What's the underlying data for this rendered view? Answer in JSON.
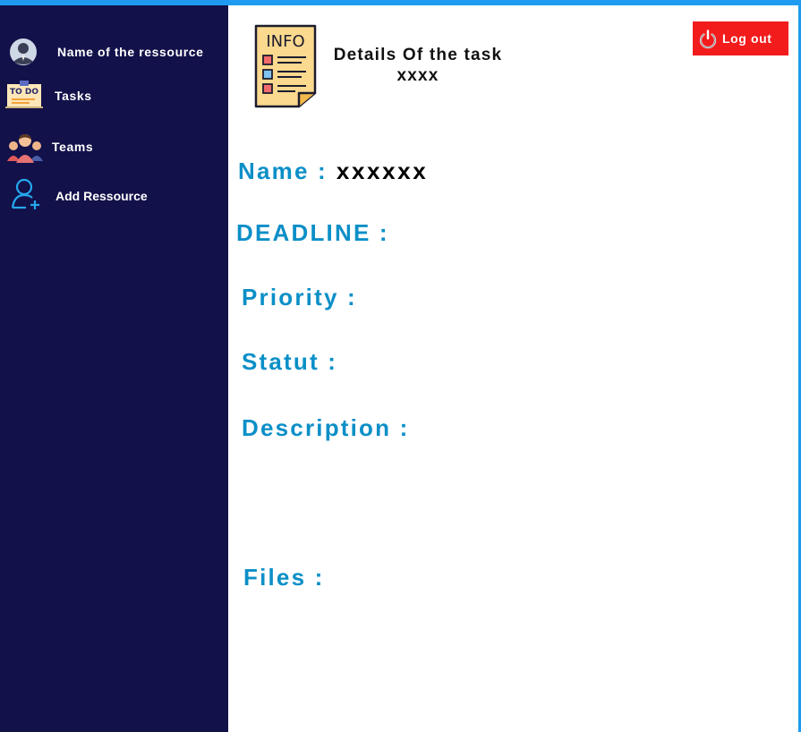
{
  "sidebar": {
    "user": {
      "label": "Name of the ressource",
      "icon": "user-avatar-icon"
    },
    "items": [
      {
        "label": "Tasks",
        "icon": "todo-note-icon"
      },
      {
        "label": "Teams",
        "icon": "team-people-icon"
      },
      {
        "label": "Add Ressource",
        "icon": "add-user-icon"
      }
    ]
  },
  "header": {
    "icon_text": "INFO",
    "icon": "info-document-icon",
    "title": "Details Of the task xxxx",
    "logout_label": "Log out",
    "logout_icon": "power-icon"
  },
  "details": {
    "name_label": "Name :",
    "name_value": "xxxxxx",
    "deadline_label": "DEADLINE :",
    "priority_label": "Priority :",
    "status_label": "Statut :",
    "description_label": "Description :",
    "files_label": "Files :"
  },
  "colors": {
    "sidebar_bg": "#12114a",
    "accent": "#1e9bf0",
    "label_blue": "#0b8fc7",
    "logout_red": "#f21c1c"
  }
}
